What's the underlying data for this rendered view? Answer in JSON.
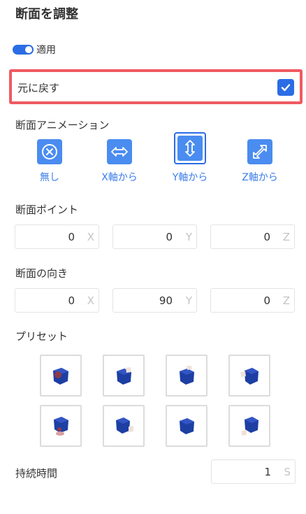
{
  "panel": {
    "title": "断面を調整"
  },
  "apply": {
    "label": "適用",
    "enabled": true
  },
  "reset": {
    "label": "元に戻す",
    "checked": true
  },
  "animation": {
    "label": "断面アニメーション",
    "options": [
      {
        "label": "無し",
        "icon": "no-animation-icon"
      },
      {
        "label": "X軸から",
        "icon": "horizontal-arrows-icon"
      },
      {
        "label": "Y軸から",
        "icon": "vertical-arrows-icon",
        "selected": true
      },
      {
        "label": "Z軸から",
        "icon": "diagonal-arrows-icon"
      }
    ]
  },
  "point": {
    "label": "断面ポイント",
    "fields": [
      {
        "value": "0",
        "unit": "X"
      },
      {
        "value": "0",
        "unit": "Y"
      },
      {
        "value": "0",
        "unit": "Z"
      }
    ]
  },
  "direction": {
    "label": "断面の向き",
    "fields": [
      {
        "value": "0",
        "unit": "X"
      },
      {
        "value": "90",
        "unit": "Y"
      },
      {
        "value": "0",
        "unit": "Z"
      }
    ]
  },
  "presets": {
    "label": "プリセット",
    "count": 8
  },
  "duration": {
    "label": "持続時間",
    "value": "1",
    "unit": "S"
  },
  "colors": {
    "accent": "#2b6de5",
    "highlight": "#ef5a60",
    "cube": "#1d3fa3"
  }
}
